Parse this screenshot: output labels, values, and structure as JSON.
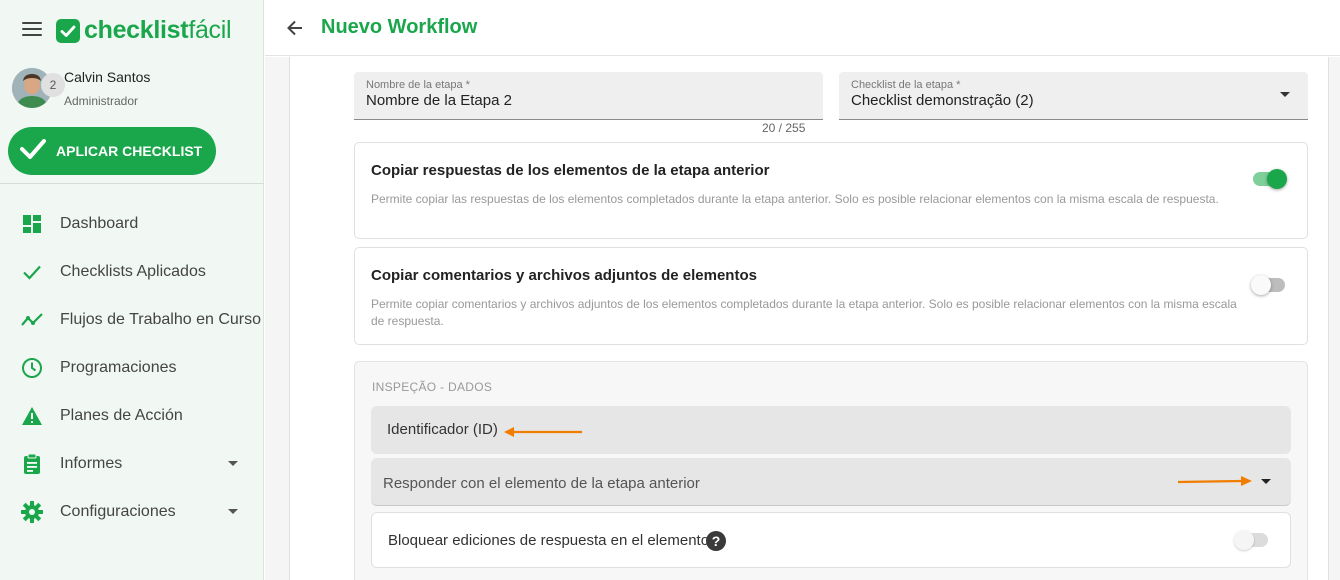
{
  "app": {
    "logo_bold": "checklist",
    "logo_light": "fácil"
  },
  "user": {
    "name": "Calvin Santos",
    "role": "Administrador"
  },
  "apply_button": {
    "label": "APLICAR CHECKLIST"
  },
  "nav": {
    "items": [
      {
        "label": "Dashboard",
        "icon": "dashboard-icon"
      },
      {
        "label": "Checklists Aplicados",
        "icon": "check-icon"
      },
      {
        "label": "Flujos de Trabalho en Curso",
        "icon": "workflow-icon"
      },
      {
        "label": "Programaciones",
        "icon": "clock-icon"
      },
      {
        "label": "Planes de Acción",
        "icon": "warning-icon"
      },
      {
        "label": "Informes",
        "icon": "clipboard-icon",
        "has_submenu": true
      },
      {
        "label": "Configuraciones",
        "icon": "gear-icon",
        "has_submenu": true
      }
    ]
  },
  "header": {
    "title": "Nuevo Workflow"
  },
  "stage": {
    "number": "2",
    "name_field": {
      "label": "Nombre de la etapa *",
      "value": "Nombre de la Etapa 2",
      "counter": "20 / 255"
    },
    "checklist_field": {
      "label": "Checklist de la etapa *",
      "value": "Checklist demonstração (2)"
    }
  },
  "options": {
    "copy_responses": {
      "title": "Copiar respuestas de los elementos de la etapa anterior",
      "description": "Permite copiar las respuestas de los elementos completados durante la etapa anterior. Solo es posible relacionar elementos con la misma escala de respuesta.",
      "enabled": true
    },
    "copy_comments": {
      "title": "Copiar comentarios y archivos adjuntos de elementos",
      "description": "Permite copiar comentarios y archivos adjuntos de los elementos completados durante la etapa anterior. Solo es posible relacionar elementos con la misma escala de respuesta.",
      "enabled": false
    }
  },
  "inspection_section": {
    "title": "INSPEÇÃO - DADOS",
    "identifier_label": "Identificador (ID)",
    "respond_select_placeholder": "Responder con el elemento de la etapa anterior",
    "lock_label": "Bloquear ediciones de respuesta en el elemento",
    "lock_enabled": false,
    "help_glyph": "?"
  },
  "colors": {
    "brand_green": "#1aa64b",
    "annotation_orange": "#f07d00"
  }
}
